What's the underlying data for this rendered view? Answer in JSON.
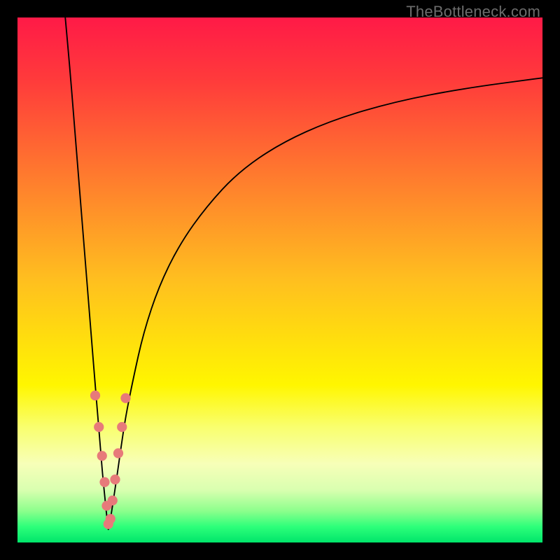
{
  "watermark": "TheBottleneck.com",
  "chart_data": {
    "type": "line",
    "title": "",
    "xlabel": "",
    "ylabel": "",
    "xlim": [
      0,
      100
    ],
    "ylim": [
      0,
      100
    ],
    "gradient_stops": [
      {
        "offset": 0.0,
        "color": "#ff1a47"
      },
      {
        "offset": 0.12,
        "color": "#ff3b3b"
      },
      {
        "offset": 0.3,
        "color": "#ff7a2e"
      },
      {
        "offset": 0.5,
        "color": "#ffbf1f"
      },
      {
        "offset": 0.7,
        "color": "#fff600"
      },
      {
        "offset": 0.78,
        "color": "#f9ff6e"
      },
      {
        "offset": 0.85,
        "color": "#f7ffb8"
      },
      {
        "offset": 0.9,
        "color": "#d9ffb0"
      },
      {
        "offset": 0.94,
        "color": "#8cff8c"
      },
      {
        "offset": 0.97,
        "color": "#2dff7a"
      },
      {
        "offset": 1.0,
        "color": "#00e56a"
      }
    ],
    "series": [
      {
        "name": "left-branch",
        "x": [
          9.1,
          10.0,
          10.8,
          11.6,
          12.4,
          13.2,
          14.0,
          14.8,
          15.3,
          15.8,
          16.2,
          16.6,
          17.0,
          17.3
        ],
        "y": [
          100.0,
          90.0,
          80.0,
          70.0,
          60.0,
          50.0,
          40.0,
          30.0,
          24.0,
          18.0,
          13.0,
          9.0,
          5.0,
          2.5
        ]
      },
      {
        "name": "right-branch",
        "x": [
          17.3,
          17.8,
          18.4,
          19.0,
          19.7,
          20.6,
          22.0,
          24.0,
          27.0,
          31.0,
          36.0,
          42.0,
          50.0,
          60.0,
          72.0,
          85.0,
          100.0
        ],
        "y": [
          2.5,
          5.0,
          9.0,
          13.0,
          18.0,
          24.0,
          31.0,
          40.0,
          49.0,
          57.0,
          64.0,
          70.5,
          76.0,
          80.5,
          84.0,
          86.5,
          88.5
        ]
      }
    ],
    "markers": {
      "name": "highlight-dots",
      "x": [
        14.8,
        15.5,
        16.1,
        16.6,
        17.0,
        17.3,
        17.7,
        18.1,
        18.6,
        19.2,
        19.9,
        20.6
      ],
      "y": [
        28.0,
        22.0,
        16.5,
        11.5,
        7.0,
        3.5,
        4.5,
        8.0,
        12.0,
        17.0,
        22.0,
        27.5
      ]
    }
  }
}
